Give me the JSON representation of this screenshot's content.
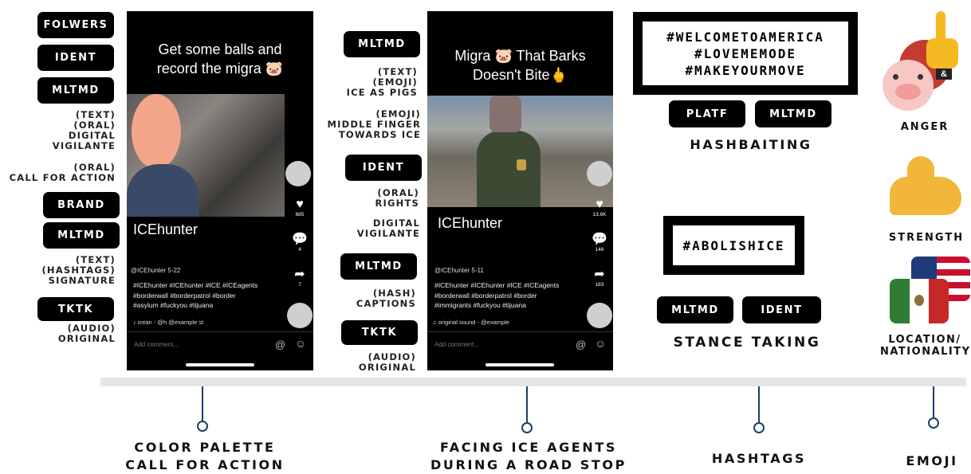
{
  "left_panel": {
    "tags": [
      "FOLWERS",
      "IDENT",
      "MLTMD",
      "BRAND",
      "MLTMD",
      "TKTK"
    ],
    "notes": {
      "text_oral_digital": [
        "(TEXT)",
        "(ORAL)",
        "DIGITAL",
        "VIGILANTE"
      ],
      "oral_call": [
        "(ORAL)",
        "CALL FOR ACTION"
      ],
      "text_hashtags": [
        "(TEXT)",
        "(HASHTAGS)",
        "SIGNATURE"
      ],
      "audio_original": [
        "(AUDIO)",
        "ORIGINAL"
      ]
    }
  },
  "phone1": {
    "caption_line1": "Get some balls and",
    "caption_line2": "record the migra",
    "caption_emoji": "🐷",
    "username": "ICEhunter",
    "handle": "@ICEhunter  5-22",
    "desc_lines": [
      "#ICEhunter #ICEhunter #ICE #ICEagents",
      "#borderwall #borderpatrol #border",
      "#asylum #fuckyou #tijuana"
    ],
    "sound": "♪  icean - @h  @example        st",
    "likes": "685",
    "comments": "4",
    "shares": "7",
    "comment_placeholder": "Add comment...",
    "at_icon": "@",
    "smile_icon": "☺"
  },
  "middle_panel": {
    "tags": [
      "MLTMD",
      "IDENT",
      "MLTMD",
      "TKTK"
    ],
    "notes": {
      "text_emoji": [
        "(TEXT)",
        "(EMOJI)",
        "ICE AS PIGS"
      ],
      "emoji_finger": [
        "(EMOJI)",
        "MIDDLE FINGER",
        "TOWARDS ICE"
      ],
      "oral_rights": [
        "(ORAL)",
        "RIGHTS"
      ],
      "digital": [
        "DIGITAL",
        "VIGILANTE"
      ],
      "hash_captions": [
        "(HASH)",
        "CAPTIONS"
      ],
      "audio_original": [
        "(AUDIO)",
        "ORIGINAL"
      ]
    }
  },
  "phone2": {
    "caption_line1_a": "Migra",
    "caption_emoji": "🐷",
    "caption_line1_b": "That Barks",
    "caption_line2": "Doesn't Bite",
    "caption_emoji2": "🖕",
    "username": "ICEhunter",
    "handle": "@ICEhunter 5-11",
    "desc_lines": [
      "#ICEhunter #ICEhunter #ICE #ICEagents",
      "#borderwall #borderpatrol #border",
      "#immigrants #fuckyou #tijuana"
    ],
    "sound": "♫     original sound - @example",
    "likes": "13.6K",
    "comments": "146",
    "shares": "183",
    "comment_placeholder": "Add comment...",
    "at_icon": "@",
    "smile_icon": "☺"
  },
  "hashtags_panel": {
    "box1_lines": [
      "#WELCOMETOAMERICA",
      "#LOVEMEMODE",
      "#MAKEYOURMOVE"
    ],
    "tags_row1": [
      "PLATF",
      "MLTMD"
    ],
    "label1": "HASHBAITING",
    "box2_text": "#ABOLISHICE",
    "tags_row2": [
      "MLTMD",
      "IDENT"
    ],
    "label2": "STANCE TAKING"
  },
  "emoji_panel": {
    "labels": [
      "ANGER",
      "STRENGTH",
      "LOCATION/",
      "NATIONALITY"
    ],
    "anger_emoji": "😡",
    "finger_emoji": "🖕",
    "ampersand": "&",
    "pig_emoji": "🐷",
    "strength_emoji": "💪",
    "us_flag": "🇺🇸",
    "mx_flag": "🇲🇽"
  },
  "timeline": {
    "labels": [
      [
        "COLOR PALETTE",
        "CALL FOR ACTION"
      ],
      [
        "FACING ICE AGENTS",
        "DURING A ROAD STOP"
      ],
      [
        "HASHTAGS"
      ],
      [
        "EMOJI"
      ]
    ]
  },
  "colors": {
    "timeline_bar": "#e4e6ea",
    "timeline_accent": "#1d3d68",
    "tag_bg": "#000000",
    "face_blur": "#f3a58a"
  }
}
